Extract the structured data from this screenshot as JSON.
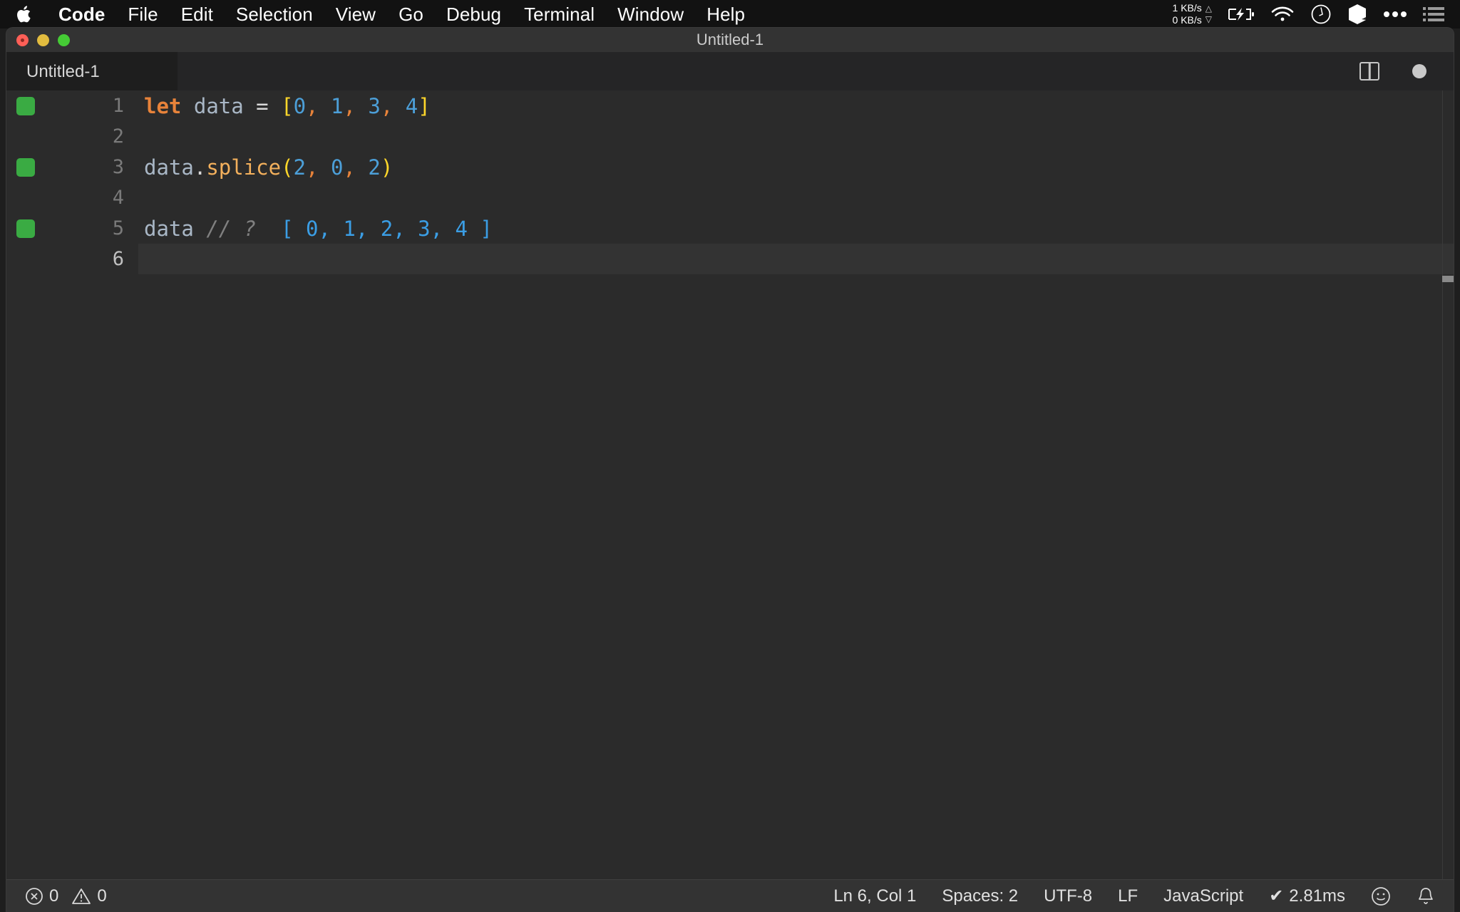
{
  "menubar": {
    "apple_icon": "apple-logo-icon",
    "items": [
      {
        "label": "Code",
        "bold": true
      },
      {
        "label": "File",
        "bold": false
      },
      {
        "label": "Edit",
        "bold": false
      },
      {
        "label": "Selection",
        "bold": false
      },
      {
        "label": "View",
        "bold": false
      },
      {
        "label": "Go",
        "bold": false
      },
      {
        "label": "Debug",
        "bold": false
      },
      {
        "label": "Terminal",
        "bold": false
      },
      {
        "label": "Window",
        "bold": false
      },
      {
        "label": "Help",
        "bold": false
      }
    ],
    "status": {
      "net_up": "1 KB/s",
      "net_down": "0 KB/s",
      "up_arrow": "△",
      "down_arrow": "▽",
      "icons": [
        "battery-charging-icon",
        "wifi-icon",
        "clock-icon",
        "cube-icon",
        "ellipsis-icon",
        "list-icon"
      ]
    }
  },
  "window": {
    "title": "Untitled-1",
    "traffic_lights": [
      "close-button",
      "minimize-button",
      "zoom-button"
    ]
  },
  "tabbar": {
    "tabs": [
      {
        "label": "Untitled-1",
        "active": true,
        "dirty": true
      }
    ],
    "actions": [
      "split-editor-icon",
      "unsaved-indicator-dot"
    ]
  },
  "editor": {
    "language": "JavaScript",
    "lines": [
      {
        "number": "1",
        "coverage": true,
        "active": false,
        "tokens": [
          {
            "text": "let",
            "type": "keyword"
          },
          {
            "text": " ",
            "type": "plain"
          },
          {
            "text": "data",
            "type": "var"
          },
          {
            "text": " ",
            "type": "plain"
          },
          {
            "text": "=",
            "type": "op"
          },
          {
            "text": " ",
            "type": "plain"
          },
          {
            "text": "[",
            "type": "bracket"
          },
          {
            "text": "0",
            "type": "num"
          },
          {
            "text": ",",
            "type": "comma"
          },
          {
            "text": " ",
            "type": "plain"
          },
          {
            "text": "1",
            "type": "num"
          },
          {
            "text": ",",
            "type": "comma"
          },
          {
            "text": " ",
            "type": "plain"
          },
          {
            "text": "3",
            "type": "num"
          },
          {
            "text": ",",
            "type": "comma"
          },
          {
            "text": " ",
            "type": "plain"
          },
          {
            "text": "4",
            "type": "num"
          },
          {
            "text": "]",
            "type": "bracket"
          }
        ]
      },
      {
        "number": "2",
        "coverage": false,
        "active": false,
        "tokens": []
      },
      {
        "number": "3",
        "coverage": true,
        "active": false,
        "tokens": [
          {
            "text": "data",
            "type": "var"
          },
          {
            "text": ".",
            "type": "dot"
          },
          {
            "text": "splice",
            "type": "fn"
          },
          {
            "text": "(",
            "type": "bracket"
          },
          {
            "text": "2",
            "type": "num"
          },
          {
            "text": ",",
            "type": "comma"
          },
          {
            "text": " ",
            "type": "plain"
          },
          {
            "text": "0",
            "type": "num"
          },
          {
            "text": ",",
            "type": "comma"
          },
          {
            "text": " ",
            "type": "plain"
          },
          {
            "text": "2",
            "type": "num"
          },
          {
            "text": ")",
            "type": "bracket"
          }
        ]
      },
      {
        "number": "4",
        "coverage": false,
        "active": false,
        "tokens": []
      },
      {
        "number": "5",
        "coverage": true,
        "active": false,
        "tokens": [
          {
            "text": "data",
            "type": "var"
          },
          {
            "text": " ",
            "type": "plain"
          },
          {
            "text": "// ?",
            "type": "comment"
          },
          {
            "text": "  ",
            "type": "plain"
          },
          {
            "text": "[ 0, 1, 2, 3, 4 ]",
            "type": "result"
          }
        ]
      },
      {
        "number": "6",
        "coverage": false,
        "active": true,
        "tokens": []
      }
    ]
  },
  "statusbar": {
    "left": {
      "error_icon": "error-circle-icon",
      "error_count": "0",
      "warning_icon": "warning-triangle-icon",
      "warning_count": "0"
    },
    "right": {
      "cursor_position": "Ln 6, Col 1",
      "indentation": "Spaces: 2",
      "encoding": "UTF-8",
      "line_ending": "LF",
      "language_mode": "JavaScript",
      "check_mark": "✔",
      "run_time": "2.81ms",
      "feedback_icon": "smiley-icon",
      "notifications_icon": "bell-icon"
    }
  },
  "colors": {
    "menubar_bg": "#121212",
    "titlebar_bg": "#333333",
    "editor_bg": "#2b2b2b",
    "statusbar_bg": "#333333",
    "coverage_green": "#3aab43",
    "keyword_orange": "#e8833a",
    "bracket_yellow": "#ffd72a",
    "number_blue": "#4c9fd8",
    "function_tan": "#f3b05c",
    "comment_gray": "#808080",
    "result_blue": "#3b9ee5"
  }
}
